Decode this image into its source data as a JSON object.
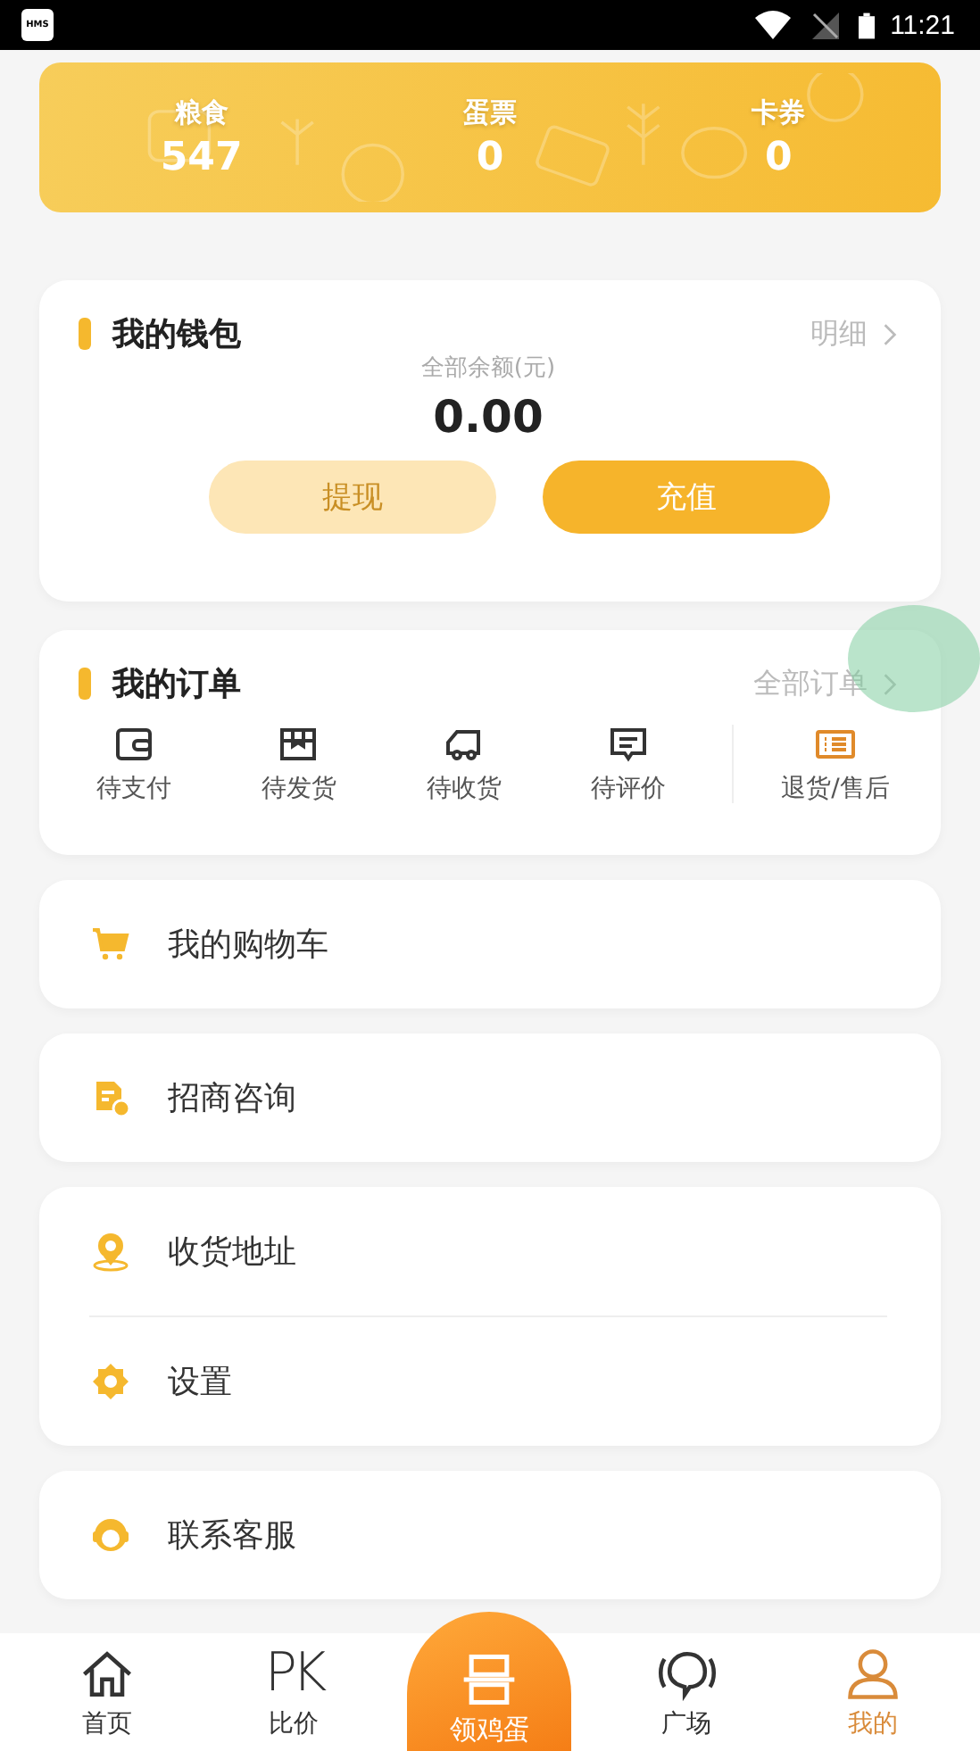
{
  "status_bar": {
    "app_badge": "HMS",
    "time": "11:21"
  },
  "assets": [
    {
      "label": "粮食",
      "value": "547"
    },
    {
      "label": "蛋票",
      "value": "0"
    },
    {
      "label": "卡券",
      "value": "0"
    }
  ],
  "wallet": {
    "title": "我的钱包",
    "link": "明细",
    "balance_label": "全部余额(元)",
    "balance": "0.00",
    "buttons": [
      {
        "label": "提现",
        "disabled": true
      },
      {
        "label": "充值",
        "disabled": false
      }
    ]
  },
  "orders": {
    "title": "我的订单",
    "link": "全部订单",
    "items": [
      {
        "label": "待支付"
      },
      {
        "label": "待发货"
      },
      {
        "label": "待收货"
      },
      {
        "label": "待评价"
      },
      {
        "label": "退货/售后"
      }
    ]
  },
  "menu_groups": [
    [
      {
        "label": "我的购物车"
      }
    ],
    [
      {
        "label": "招商咨询"
      }
    ],
    [
      {
        "label": "收货地址"
      },
      {
        "label": "设置"
      }
    ],
    [
      {
        "label": "联系客服"
      }
    ]
  ],
  "tab_bar": [
    {
      "label": "首页",
      "kind": "tab",
      "selected": false
    },
    {
      "label": "比价",
      "icon_text": "PK",
      "kind": "tab",
      "selected": false
    },
    {
      "label": "领鸡蛋",
      "kind": "center",
      "selected": false
    },
    {
      "label": "广场",
      "kind": "tab",
      "selected": false
    },
    {
      "label": "我的",
      "kind": "tab",
      "selected": true
    }
  ]
}
